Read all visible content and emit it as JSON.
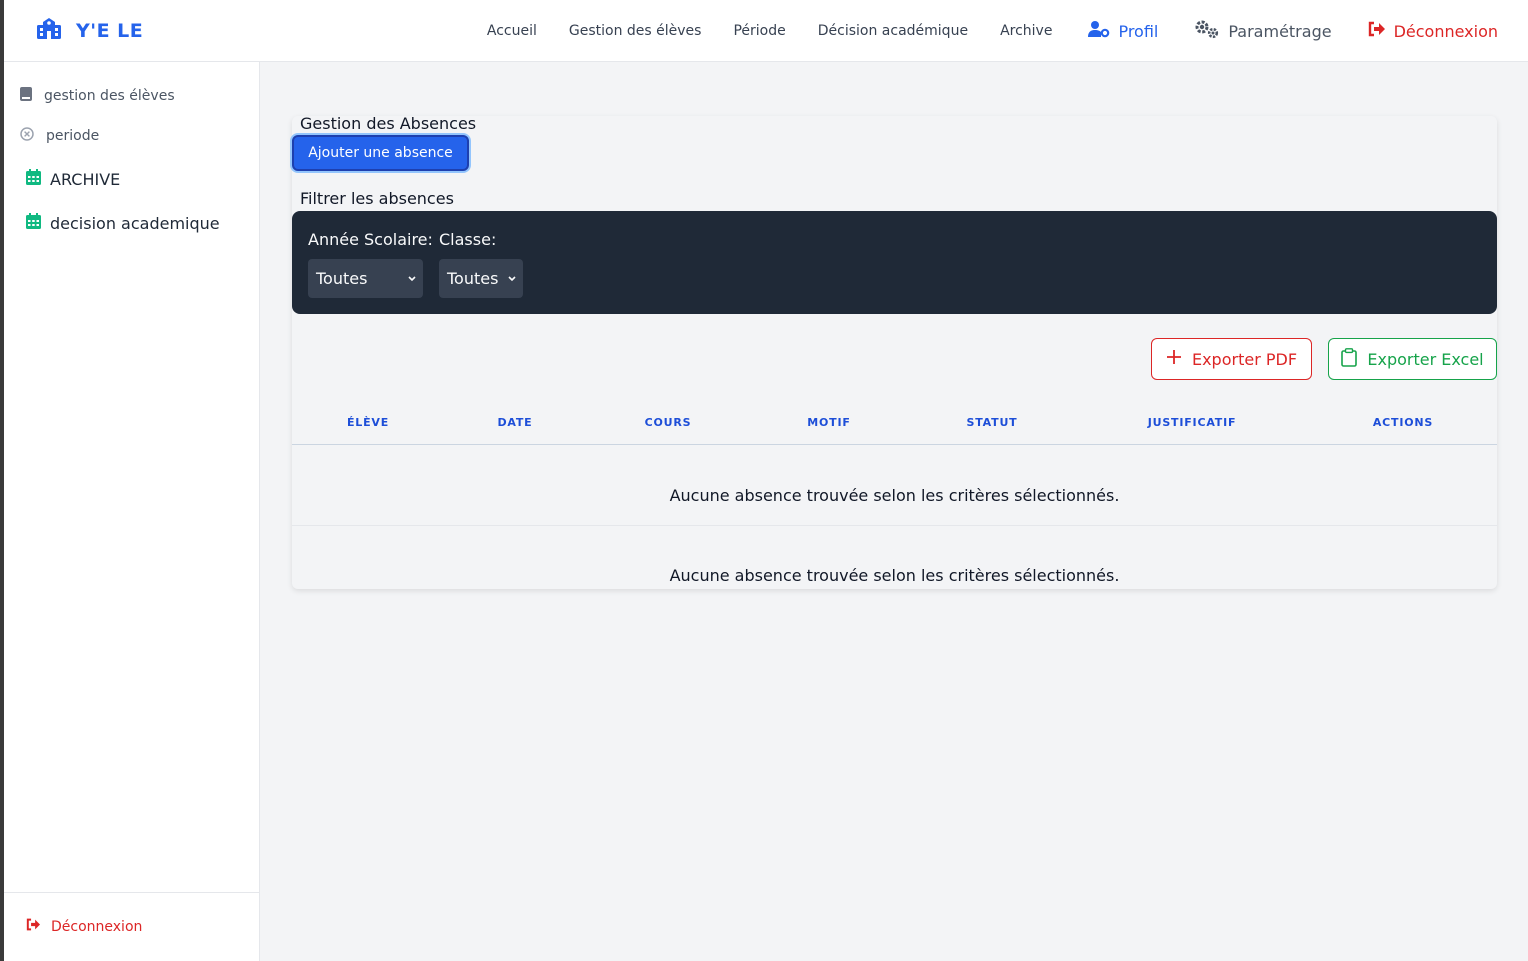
{
  "brand": {
    "name": "Y'E LE"
  },
  "nav": {
    "links": [
      "Accueil",
      "Gestion des élèves",
      "Période",
      "Décision académique",
      "Archive"
    ],
    "profil": "Profil",
    "parametrage": "Paramétrage",
    "deconnexion": "Déconnexion"
  },
  "sidebar": {
    "items": [
      {
        "label": "gestion des élèves",
        "icon": "book-icon"
      },
      {
        "label": "periode",
        "icon": "circle-x-icon"
      },
      {
        "label": "ARCHIVE",
        "icon": "calendar-icon"
      },
      {
        "label": "decision academique",
        "icon": "calendar-icon"
      }
    ],
    "logout": "Déconnexion"
  },
  "main": {
    "title": "Gestion des Absences",
    "add_button": "Ajouter une absence",
    "filter_title": "Filtrer les absences",
    "filters": {
      "annee_label": "Année Scolaire:",
      "annee_value": "Toutes",
      "classe_label": "Classe:",
      "classe_value": "Toutes"
    },
    "export_pdf": "Exporter PDF",
    "export_excel": "Exporter Excel",
    "table": {
      "columns": [
        "ÉLÈVE",
        "DATE",
        "COURS",
        "MOTIF",
        "STATUT",
        "JUSTIFICATIF",
        "ACTIONS"
      ],
      "empty_message": "Aucune absence trouvée selon les critères sélectionnés.",
      "empty_message_2": "Aucune absence trouvée selon les critères sélectionnés."
    }
  },
  "colors": {
    "accent": "#2563eb",
    "danger": "#dc2626",
    "success": "#16a34a",
    "panel": "#1f2937",
    "sidebar_icon_green": "#10b981"
  }
}
